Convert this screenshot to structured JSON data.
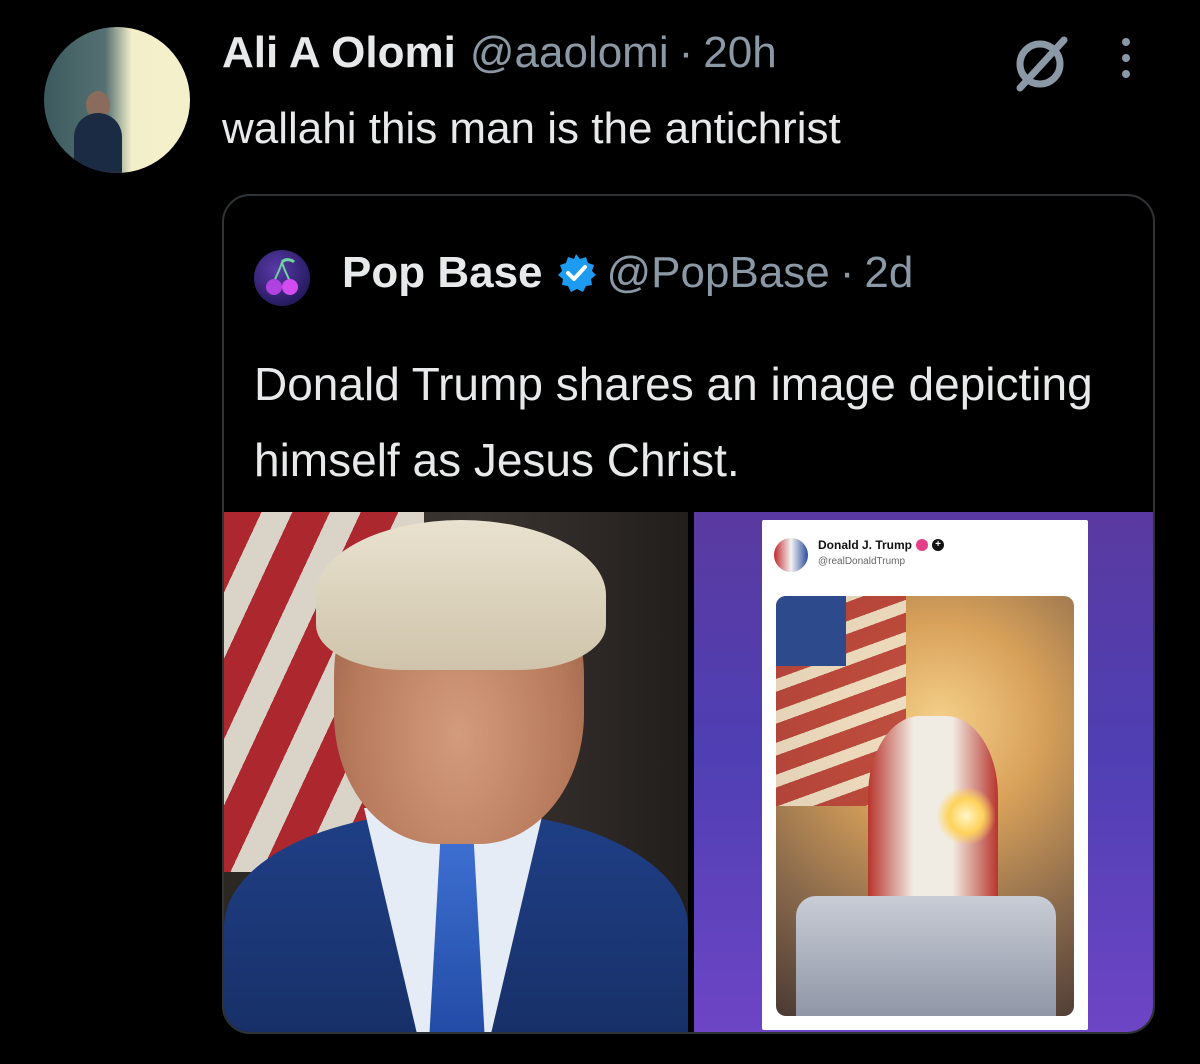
{
  "tweet": {
    "author_name": "Ali A Olomi",
    "author_handle": "@aaolomi",
    "separator": "·",
    "time": "20h",
    "text": "wallahi this man is the antichrist",
    "icons": [
      "grok-icon",
      "more-icon"
    ]
  },
  "quote": {
    "author_name": "Pop Base",
    "author_handle": "@PopBase",
    "separator": "·",
    "time": "2d",
    "text": "Donald Trump shares an image depicting himself as Jesus Christ.",
    "verified": true,
    "embedded_post": {
      "author_name": "Donald J. Trump",
      "author_handle": "@realDonaldTrump",
      "plus_symbol": "+"
    }
  },
  "colors": {
    "background": "#000000",
    "text_primary": "#e7e9ea",
    "text_secondary": "#8b98a5",
    "border": "#2f3336",
    "verified_blue": "#1d9bf0"
  }
}
